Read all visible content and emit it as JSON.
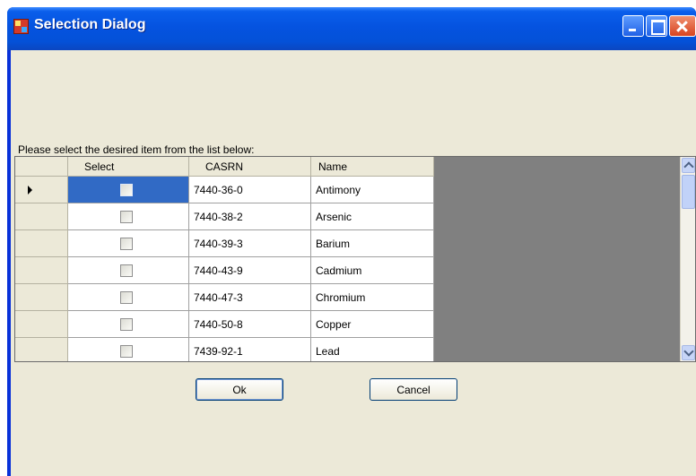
{
  "window": {
    "title": "Selection Dialog",
    "title_bar_color": "#0553e0",
    "icons": [
      "app-icon",
      "minimize-icon",
      "maximize-icon",
      "close-icon"
    ]
  },
  "dialog": {
    "prompt": "Please select the desired item from the list below:"
  },
  "grid": {
    "columns": [
      "Select",
      "CASRN",
      "Name"
    ],
    "selected_row_color": "#316ac5",
    "rows": [
      {
        "checked": false,
        "casrn": "7440-36-0",
        "name": "Antimony",
        "current": true
      },
      {
        "checked": false,
        "casrn": "7440-38-2",
        "name": "Arsenic",
        "current": false
      },
      {
        "checked": false,
        "casrn": "7440-39-3",
        "name": "Barium",
        "current": false
      },
      {
        "checked": false,
        "casrn": "7440-43-9",
        "name": "Cadmium",
        "current": false
      },
      {
        "checked": false,
        "casrn": "7440-47-3",
        "name": "Chromium",
        "current": false
      },
      {
        "checked": false,
        "casrn": "7440-50-8",
        "name": "Copper",
        "current": false
      },
      {
        "checked": false,
        "casrn": "7439-92-1",
        "name": "Lead",
        "current": false
      }
    ]
  },
  "buttons": {
    "ok_label": "Ok",
    "cancel_label": "Cancel"
  }
}
